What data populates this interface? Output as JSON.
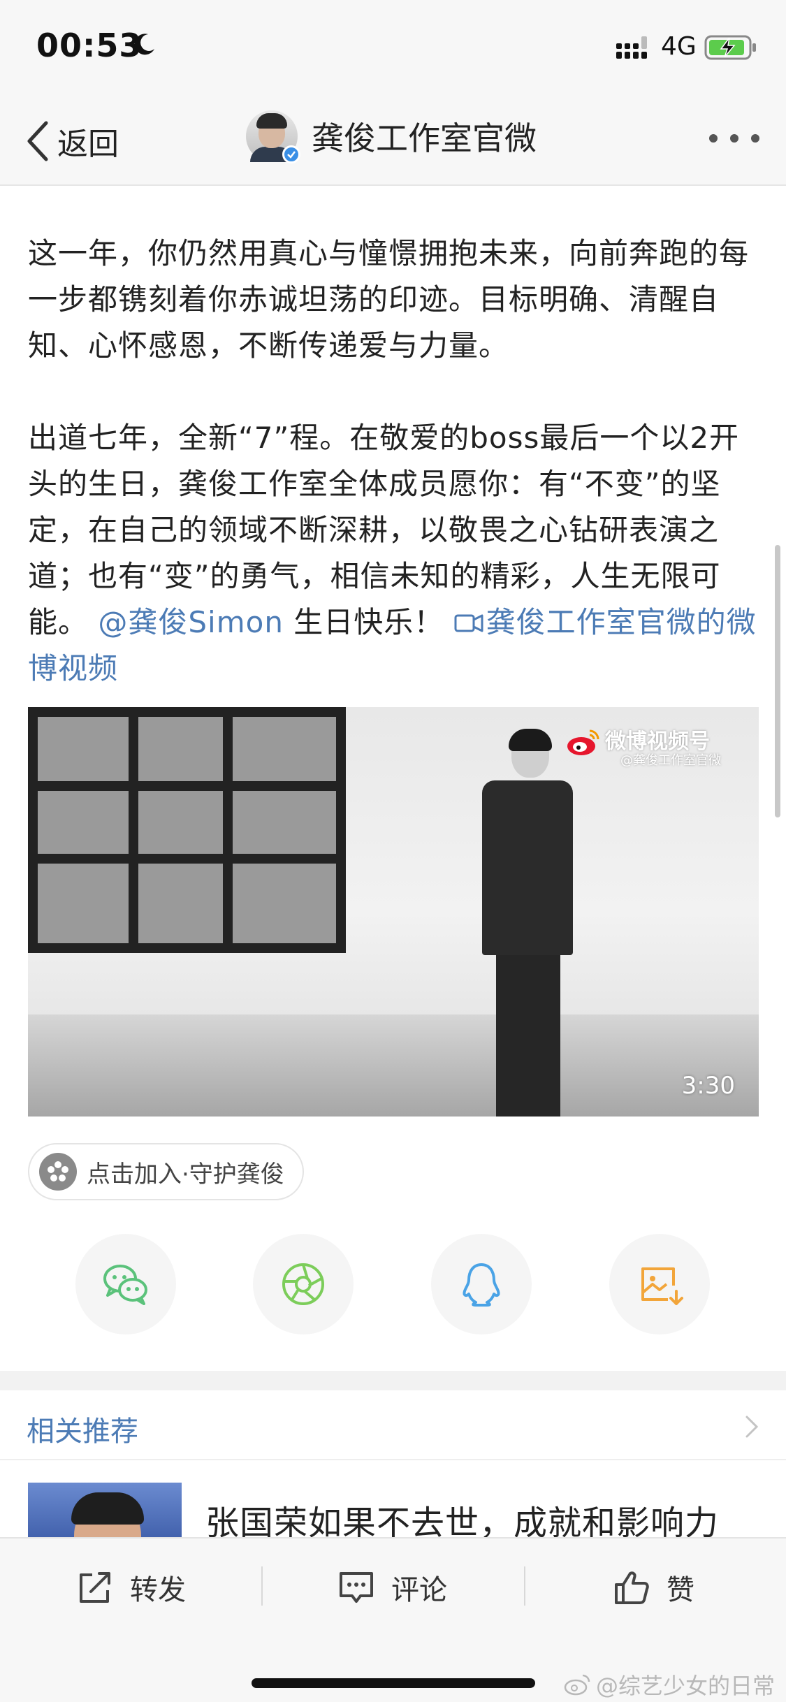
{
  "status_bar": {
    "time": "00:53",
    "network": "4G",
    "icons": [
      "moon-icon",
      "signal-icon",
      "battery-charging-icon"
    ]
  },
  "nav": {
    "back_label": "返回",
    "title": "龚俊工作室官微",
    "icons": [
      "back-chevron-icon",
      "verified-badge-icon",
      "more-dots-icon"
    ]
  },
  "post": {
    "paragraph1": "这一年，你仍然用真心与憧憬拥抱未来，向前奔跑的每一步都镌刻着你赤诚坦荡的印迹。目标明确、清醒自知、心怀感恩，不断传递爱与力量。",
    "paragraph2_text": "出道七年，全新“7”程。在敬爱的boss最后一个以2开头的生日，龚俊工作室全体成员愿你：有“不变”的坚定，在自己的领域不断深耕，以敬畏之心钻研表演之道；也有“变”的勇气，相信未知的精彩，人生无限可能。",
    "mention": "@龚俊Simon",
    "after_mention": " 生日快乐！ ",
    "video_link": "龚俊工作室官微的微博视频"
  },
  "video": {
    "watermark_title": "微博视频号",
    "watermark_sub": "@龚俊工作室官微",
    "duration": "3:30"
  },
  "topic_chip": {
    "label": "点击加入·守护龚俊"
  },
  "share": {
    "icons": [
      "wechat-icon",
      "moments-icon",
      "qq-icon",
      "save-image-icon"
    ],
    "colors": {
      "wechat": "#5bc27b",
      "moments": "#7ccd5a",
      "qq": "#4aa3e6",
      "save": "#f2a53a"
    }
  },
  "related": {
    "title": "相关推荐",
    "item_text": "张国荣如果不去世，成就和影响力"
  },
  "toolbar": {
    "repost": "转发",
    "comment": "评论",
    "like": "赞"
  },
  "corner_watermark": "@综艺少女的日常",
  "colors": {
    "link": "#4c7bb5",
    "text": "#222222",
    "bar_bg": "#f7f7f7"
  }
}
